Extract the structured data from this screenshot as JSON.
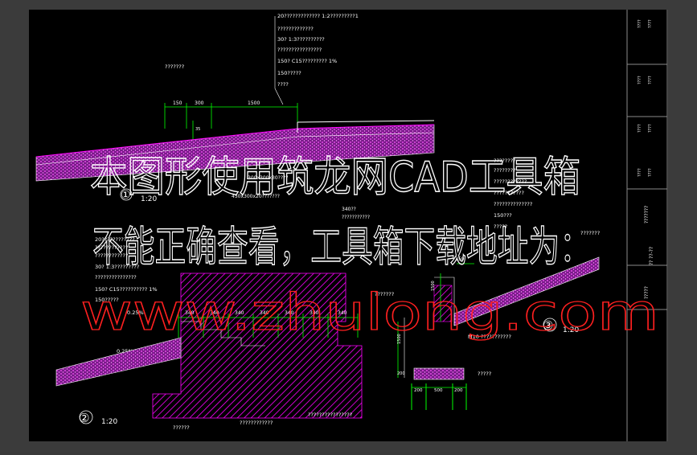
{
  "colors": {
    "frame_bg": "#3b3b3b",
    "sheet_bg": "#000000",
    "cad_text": "#ffffff",
    "cad_line": "#ffffff",
    "hatch": "#ff00ff",
    "dimension": "#00ff00",
    "section_cut": "#ff0000",
    "grid_line": "#7a7a7a",
    "watermark_white": "#ffffff",
    "watermark_red": "#ff2020"
  },
  "notes_top": [
    "20?????????????   1:2?????????1",
    "?????????????",
    "30? 1:3??????????",
    "????????????????",
    "150? C15?????????     1%",
    "150?????",
    "????"
  ],
  "label_top_left": "???????",
  "dims_top": [
    "150",
    "300",
    "1500"
  ],
  "dim_small_top": "35",
  "detail1": {
    "marker": "①",
    "scale": "1:20"
  },
  "notes_mid": [
    "300x300x30????",
    "450x300x20???????",
    "340??",
    "???????????"
  ],
  "notes_right_mid": [
    "????????",
    "????????",
    "????????????",
    "???????????",
    "??????????????",
    "150???",
    "?????"
  ],
  "notes_right_edge": "???????",
  "notes_left_mid": [
    "20????????????",
    "????????????",
    "????????????",
    "30? 1:3?????????",
    "???????????????",
    "150? C15??????????   1%",
    "150?????"
  ],
  "slope_a": "0.25%",
  "slope_b": "0.25%",
  "dims_stairs": [
    "340",
    "340",
    "340",
    "340",
    "340",
    "340",
    "340"
  ],
  "dims_detail3": [
    "350",
    "1500"
  ],
  "label_detail3_left": "???????",
  "label_m10": "M10 ???????????",
  "detail3": {
    "marker": "③",
    "scale": "1:20"
  },
  "detail2": {
    "marker": "②",
    "scale": "1:20"
  },
  "dims_bottom": [
    "200",
    "500",
    "200"
  ],
  "dim_vertical": "1500",
  "dim_small_bottom": "200",
  "label_right_bottom": "?????",
  "labels_bottom": [
    "??????",
    "????????????",
    "????????????????"
  ],
  "title_block_labels": [
    "????",
    "????",
    "????",
    "????",
    "????",
    "????",
    "????",
    "????"
  ],
  "title_block_vertical": "?? ??-??",
  "watermark": {
    "line1": "本图形使用筑龙网CAD工具箱",
    "line2": "不能正确查看，工具箱下载地址为：",
    "line3": "www.zhulong.com"
  }
}
